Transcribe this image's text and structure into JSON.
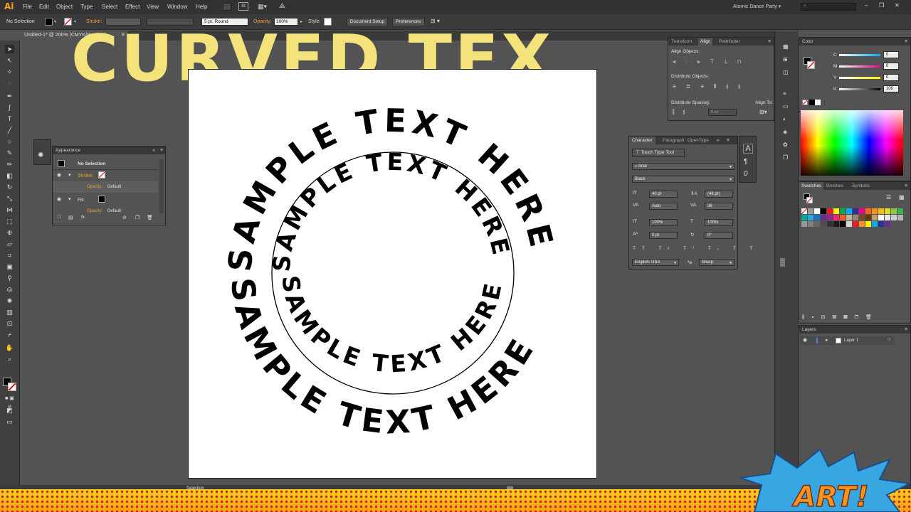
{
  "menubar": {
    "logo": "Ai",
    "items": [
      "File",
      "Edit",
      "Object",
      "Type",
      "Select",
      "Effect",
      "View",
      "Window",
      "Help"
    ],
    "badge": "St",
    "workspace": "Atomic Dance Party"
  },
  "controlbar": {
    "selection": "No Selection",
    "stroke_label": "Stroke:",
    "brush": "5 pt. Round",
    "opacity_label": "Opacity:",
    "opacity_value": "100%",
    "style_label": "Style:",
    "document_setup": "Document Setup",
    "preferences": "Preferences"
  },
  "document_tab": {
    "title": "Untitled-1* @ 200% (CMYK/Preview)"
  },
  "background_text": "CURVED TEX",
  "artwork": {
    "outer_text": "SAMPLE TEXT HERE",
    "inner_text": "SAMPLE TEXT HERE"
  },
  "appearance": {
    "tab": "Appearance",
    "header": "No Selection",
    "stroke_label": "Stroke:",
    "opacity1_label": "Opacity:",
    "opacity1_value": "Default",
    "fill_label": "Fill:",
    "opacity2_label": "Opacity:",
    "opacity2_value": "Default",
    "fx": "fx."
  },
  "align": {
    "tabs": [
      "Transform",
      "Align",
      "Pathfinder"
    ],
    "align_objects": "Align Objects:",
    "distribute_objects": "Distribute Objects:",
    "distribute_spacing": "Distribute Spacing:",
    "align_to": "Align To:",
    "spacing_value": "0 in"
  },
  "character": {
    "tabs": [
      "Character",
      "Paragraph",
      "OpenType"
    ],
    "touch_tool": "Touch Type Tool",
    "font_family": "Arial",
    "font_style": "Black",
    "size": "40 pt",
    "leading": "(48 pt)",
    "kerning": "Auto",
    "tracking": "36",
    "vscale": "100%",
    "hscale": "100%",
    "baseline": "0 pt",
    "rotation": "0°",
    "language": "English: USA",
    "aa_label": "a",
    "antialias": "Sharp"
  },
  "color": {
    "tab": "Color",
    "labels": [
      "C",
      "M",
      "Y",
      "K"
    ],
    "values": [
      "0",
      "0",
      "0",
      "100"
    ]
  },
  "swatches": {
    "tabs": [
      "Swatches",
      "Brushes",
      "Symbols"
    ]
  },
  "layers": {
    "tab": "Layers",
    "layer_name": "Layer 1"
  },
  "status": {
    "tool": "Selection"
  },
  "banner": {
    "art_label": "ART!"
  }
}
